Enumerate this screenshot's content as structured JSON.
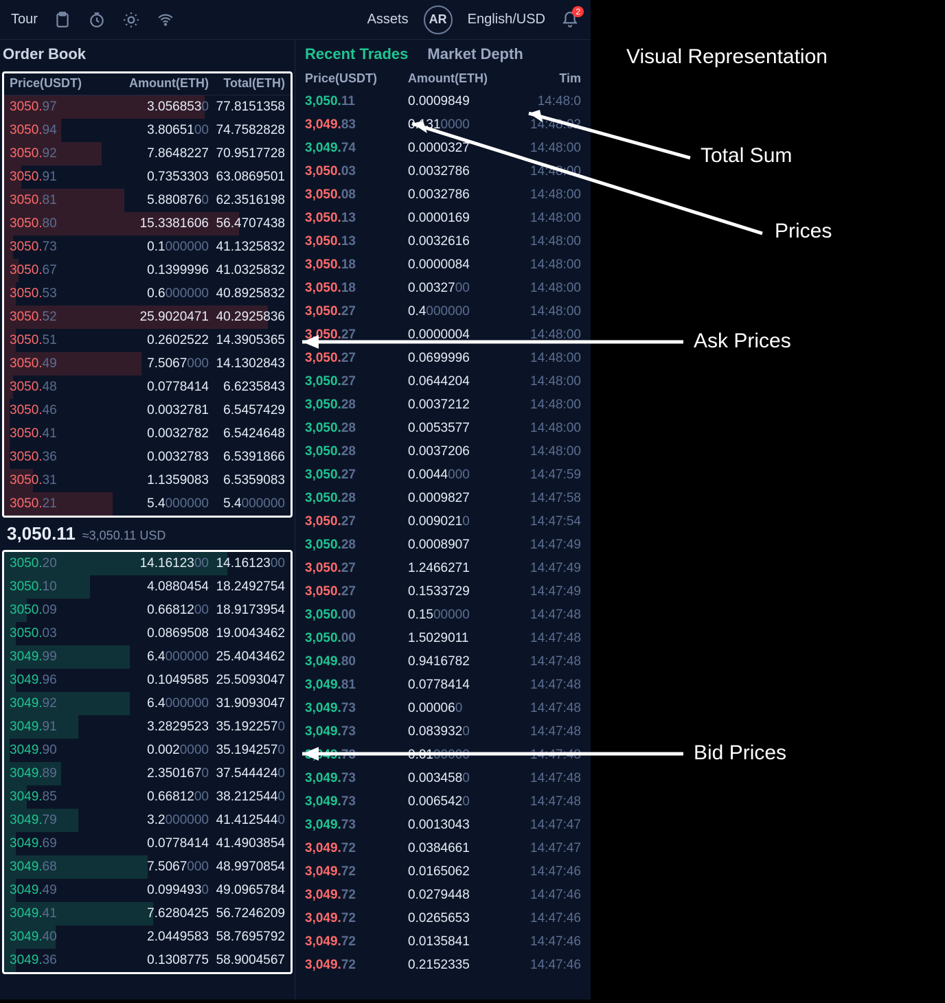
{
  "topbar": {
    "tour": "Tour",
    "assets": "Assets",
    "avatar": "AR",
    "locale": "English/USD",
    "notif_badge": "2"
  },
  "orderbook": {
    "title": "Order Book",
    "head_price": "Price(USDT)",
    "head_amount": "Amount(ETH)",
    "head_total": "Total(ETH)",
    "mid_price_main": "3,050.11",
    "mid_price_sub": "≈3,050.11 USD",
    "asks": [
      {
        "p": [
          "3050.",
          "97"
        ],
        "a": [
          "3.056853",
          "0"
        ],
        "t": [
          "77.8151358",
          ""
        ],
        "d": 70
      },
      {
        "p": [
          "3050.",
          "94"
        ],
        "a": [
          "3.80651",
          "00"
        ],
        "t": [
          "74.7582828",
          ""
        ],
        "d": 20
      },
      {
        "p": [
          "3050.",
          "92"
        ],
        "a": [
          "7.8648227",
          ""
        ],
        "t": [
          "70.9517728",
          ""
        ],
        "d": 34
      },
      {
        "p": [
          "3050.",
          "91"
        ],
        "a": [
          "0.7353303",
          ""
        ],
        "t": [
          "63.0869501",
          ""
        ],
        "d": 6
      },
      {
        "p": [
          "3050.",
          "81"
        ],
        "a": [
          "5.880876",
          "0"
        ],
        "t": [
          "62.3516198",
          ""
        ],
        "d": 42
      },
      {
        "p": [
          "3050.",
          "80"
        ],
        "a": [
          "15.3381606",
          ""
        ],
        "t": [
          "56.4707438",
          ""
        ],
        "d": 82
      },
      {
        "p": [
          "3050.",
          "73"
        ],
        "a": [
          "0.1",
          "000000"
        ],
        "t": [
          "41.1325832",
          ""
        ],
        "d": 3
      },
      {
        "p": [
          "3050.",
          "67"
        ],
        "a": [
          "0.1399996",
          ""
        ],
        "t": [
          "41.0325832",
          ""
        ],
        "d": 5
      },
      {
        "p": [
          "3050.",
          "53"
        ],
        "a": [
          "0.6",
          "000000"
        ],
        "t": [
          "40.8925832",
          ""
        ],
        "d": 4
      },
      {
        "p": [
          "3050.",
          "52"
        ],
        "a": [
          "25.9020471",
          ""
        ],
        "t": [
          "40.2925836",
          ""
        ],
        "d": 92
      },
      {
        "p": [
          "3050.",
          "51"
        ],
        "a": [
          "0.2602522",
          ""
        ],
        "t": [
          "14.3905365",
          ""
        ],
        "d": 4
      },
      {
        "p": [
          "3050.",
          "49"
        ],
        "a": [
          "7.5067",
          "000"
        ],
        "t": [
          "14.1302843",
          ""
        ],
        "d": 48
      },
      {
        "p": [
          "3050.",
          "48"
        ],
        "a": [
          "0.0778414",
          ""
        ],
        "t": [
          "6.6235843",
          ""
        ],
        "d": 3
      },
      {
        "p": [
          "3050.",
          "46"
        ],
        "a": [
          "0.0032781",
          ""
        ],
        "t": [
          "6.5457429",
          ""
        ],
        "d": 2
      },
      {
        "p": [
          "3050.",
          "41"
        ],
        "a": [
          "0.0032782",
          ""
        ],
        "t": [
          "6.5424648",
          ""
        ],
        "d": 2
      },
      {
        "p": [
          "3050.",
          "36"
        ],
        "a": [
          "0.0032783",
          ""
        ],
        "t": [
          "6.5391866",
          ""
        ],
        "d": 2
      },
      {
        "p": [
          "3050.",
          "31"
        ],
        "a": [
          "1.1359083",
          ""
        ],
        "t": [
          "6.5359083",
          ""
        ],
        "d": 10
      },
      {
        "p": [
          "3050.",
          "21"
        ],
        "a": [
          "5.4",
          "000000"
        ],
        "t": [
          "5.4",
          "000000"
        ],
        "d": 38
      }
    ],
    "bids": [
      {
        "p": [
          "3050.",
          "20"
        ],
        "a": [
          "14.16123",
          "00"
        ],
        "t": [
          "14.16123",
          "00"
        ],
        "d": 78
      },
      {
        "p": [
          "3050.",
          "10"
        ],
        "a": [
          "4.0880454",
          ""
        ],
        "t": [
          "18.2492754",
          ""
        ],
        "d": 30
      },
      {
        "p": [
          "3050.",
          "09"
        ],
        "a": [
          "0.66812",
          "00"
        ],
        "t": [
          "18.9173954",
          ""
        ],
        "d": 8
      },
      {
        "p": [
          "3050.",
          "03"
        ],
        "a": [
          "0.0869508",
          ""
        ],
        "t": [
          "19.0043462",
          ""
        ],
        "d": 4
      },
      {
        "p": [
          "3049.",
          "99"
        ],
        "a": [
          "6.4",
          "000000"
        ],
        "t": [
          "25.4043462",
          ""
        ],
        "d": 44
      },
      {
        "p": [
          "3049.",
          "96"
        ],
        "a": [
          "0.1049585",
          ""
        ],
        "t": [
          "25.5093047",
          ""
        ],
        "d": 4
      },
      {
        "p": [
          "3049.",
          "92"
        ],
        "a": [
          "6.4",
          "000000"
        ],
        "t": [
          "31.9093047",
          ""
        ],
        "d": 44
      },
      {
        "p": [
          "3049.",
          "91"
        ],
        "a": [
          "3.2829523",
          ""
        ],
        "t": [
          "35.192257",
          "0"
        ],
        "d": 26
      },
      {
        "p": [
          "3049.",
          "90"
        ],
        "a": [
          "0.002",
          "0000"
        ],
        "t": [
          "35.194257",
          "0"
        ],
        "d": 2
      },
      {
        "p": [
          "3049.",
          "89"
        ],
        "a": [
          "2.350167",
          "0"
        ],
        "t": [
          "37.544424",
          "0"
        ],
        "d": 20
      },
      {
        "p": [
          "3049.",
          "85"
        ],
        "a": [
          "0.66812",
          "00"
        ],
        "t": [
          "38.212544",
          "0"
        ],
        "d": 8
      },
      {
        "p": [
          "3049.",
          "79"
        ],
        "a": [
          "3.2",
          "000000"
        ],
        "t": [
          "41.412544",
          "0"
        ],
        "d": 26
      },
      {
        "p": [
          "3049.",
          "69"
        ],
        "a": [
          "0.0778414",
          ""
        ],
        "t": [
          "41.4903854",
          ""
        ],
        "d": 4
      },
      {
        "p": [
          "3049.",
          "68"
        ],
        "a": [
          "7.5067",
          "000"
        ],
        "t": [
          "48.9970854",
          ""
        ],
        "d": 50
      },
      {
        "p": [
          "3049.",
          "49"
        ],
        "a": [
          "0.099493",
          "0"
        ],
        "t": [
          "49.0965784",
          ""
        ],
        "d": 4
      },
      {
        "p": [
          "3049.",
          "41"
        ],
        "a": [
          "7.6280425",
          ""
        ],
        "t": [
          "56.7246209",
          ""
        ],
        "d": 52
      },
      {
        "p": [
          "3049.",
          "40"
        ],
        "a": [
          "2.0449583",
          ""
        ],
        "t": [
          "58.7695792",
          ""
        ],
        "d": 18
      },
      {
        "p": [
          "3049.",
          "36"
        ],
        "a": [
          "0.1308775",
          ""
        ],
        "t": [
          "58.9004567",
          ""
        ],
        "d": 4
      }
    ]
  },
  "trades": {
    "tab_recent": "Recent Trades",
    "tab_depth": "Market Depth",
    "head_price": "Price(USDT)",
    "head_amount": "Amount(ETH)",
    "head_time": "Tim",
    "rows": [
      {
        "s": "buy",
        "p": [
          "3,050.",
          "11"
        ],
        "a": [
          "0.0009849",
          ""
        ],
        "t": "14:48:0"
      },
      {
        "s": "sell",
        "p": [
          "3,049.",
          "83"
        ],
        "a": [
          "0.131",
          "0000"
        ],
        "t": "14:48:02"
      },
      {
        "s": "buy",
        "p": [
          "3,049.",
          "74"
        ],
        "a": [
          "0.0000327",
          ""
        ],
        "t": "14:48:00"
      },
      {
        "s": "sell",
        "p": [
          "3,050.",
          "03"
        ],
        "a": [
          "0.0032786",
          ""
        ],
        "t": "14:48:00"
      },
      {
        "s": "sell",
        "p": [
          "3,050.",
          "08"
        ],
        "a": [
          "0.0032786",
          ""
        ],
        "t": "14:48:00"
      },
      {
        "s": "sell",
        "p": [
          "3,050.",
          "13"
        ],
        "a": [
          "0.0000169",
          ""
        ],
        "t": "14:48:00"
      },
      {
        "s": "sell",
        "p": [
          "3,050.",
          "13"
        ],
        "a": [
          "0.0032616",
          ""
        ],
        "t": "14:48:00"
      },
      {
        "s": "sell",
        "p": [
          "3,050.",
          "18"
        ],
        "a": [
          "0.0000084",
          ""
        ],
        "t": "14:48:00"
      },
      {
        "s": "sell",
        "p": [
          "3,050.",
          "18"
        ],
        "a": [
          "0.00327",
          "00"
        ],
        "t": "14:48:00"
      },
      {
        "s": "sell",
        "p": [
          "3,050.",
          "27"
        ],
        "a": [
          "0.4",
          "000000"
        ],
        "t": "14:48:00"
      },
      {
        "s": "sell",
        "p": [
          "3,050.",
          "27"
        ],
        "a": [
          "0.0000004",
          ""
        ],
        "t": "14:48:00"
      },
      {
        "s": "sell",
        "p": [
          "3,050.",
          "27"
        ],
        "a": [
          "0.0699996",
          ""
        ],
        "t": "14:48:00"
      },
      {
        "s": "buy",
        "p": [
          "3,050.",
          "27"
        ],
        "a": [
          "0.0644204",
          ""
        ],
        "t": "14:48:00"
      },
      {
        "s": "buy",
        "p": [
          "3,050.",
          "28"
        ],
        "a": [
          "0.0037212",
          ""
        ],
        "t": "14:48:00"
      },
      {
        "s": "buy",
        "p": [
          "3,050.",
          "28"
        ],
        "a": [
          "0.0053577",
          ""
        ],
        "t": "14:48:00"
      },
      {
        "s": "buy",
        "p": [
          "3,050.",
          "28"
        ],
        "a": [
          "0.0037206",
          ""
        ],
        "t": "14:48:00"
      },
      {
        "s": "buy",
        "p": [
          "3,050.",
          "27"
        ],
        "a": [
          "0.0044",
          "000"
        ],
        "t": "14:47:59"
      },
      {
        "s": "buy",
        "p": [
          "3,050.",
          "28"
        ],
        "a": [
          "0.0009827",
          ""
        ],
        "t": "14:47:58"
      },
      {
        "s": "sell",
        "p": [
          "3,050.",
          "27"
        ],
        "a": [
          "0.009021",
          "0"
        ],
        "t": "14:47:54"
      },
      {
        "s": "buy",
        "p": [
          "3,050.",
          "28"
        ],
        "a": [
          "0.0008907",
          ""
        ],
        "t": "14:47:49"
      },
      {
        "s": "sell",
        "p": [
          "3,050.",
          "27"
        ],
        "a": [
          "1.2466271",
          ""
        ],
        "t": "14:47:49"
      },
      {
        "s": "sell",
        "p": [
          "3,050.",
          "27"
        ],
        "a": [
          "0.1533729",
          ""
        ],
        "t": "14:47:49"
      },
      {
        "s": "buy",
        "p": [
          "3,050.",
          "00"
        ],
        "a": [
          "0.15",
          "00000"
        ],
        "t": "14:47:48"
      },
      {
        "s": "buy",
        "p": [
          "3,050.",
          "00"
        ],
        "a": [
          "1.5029011",
          ""
        ],
        "t": "14:47:48"
      },
      {
        "s": "buy",
        "p": [
          "3,049.",
          "80"
        ],
        "a": [
          "0.9416782",
          ""
        ],
        "t": "14:47:48"
      },
      {
        "s": "buy",
        "p": [
          "3,049.",
          "81"
        ],
        "a": [
          "0.0778414",
          ""
        ],
        "t": "14:47:48"
      },
      {
        "s": "buy",
        "p": [
          "3,049.",
          "73"
        ],
        "a": [
          "0.00006",
          "0"
        ],
        "t": "14:47:48"
      },
      {
        "s": "buy",
        "p": [
          "3,049.",
          "73"
        ],
        "a": [
          "0.083932",
          "0"
        ],
        "t": "14:47:48"
      },
      {
        "s": "buy",
        "p": [
          "3,049.",
          "73"
        ],
        "a": [
          "0.01",
          "00000"
        ],
        "t": "14:47:48"
      },
      {
        "s": "buy",
        "p": [
          "3,049.",
          "73"
        ],
        "a": [
          "0.003458",
          "0"
        ],
        "t": "14:47:48"
      },
      {
        "s": "buy",
        "p": [
          "3,049.",
          "73"
        ],
        "a": [
          "0.006542",
          "0"
        ],
        "t": "14:47:48"
      },
      {
        "s": "buy",
        "p": [
          "3,049.",
          "73"
        ],
        "a": [
          "0.0013043",
          ""
        ],
        "t": "14:47:47"
      },
      {
        "s": "sell",
        "p": [
          "3,049.",
          "72"
        ],
        "a": [
          "0.0384661",
          ""
        ],
        "t": "14:47:47"
      },
      {
        "s": "sell",
        "p": [
          "3,049.",
          "72"
        ],
        "a": [
          "0.0165062",
          ""
        ],
        "t": "14:47:46"
      },
      {
        "s": "sell",
        "p": [
          "3,049.",
          "72"
        ],
        "a": [
          "0.0279448",
          ""
        ],
        "t": "14:47:46"
      },
      {
        "s": "sell",
        "p": [
          "3,049.",
          "72"
        ],
        "a": [
          "0.0265653",
          ""
        ],
        "t": "14:47:46"
      },
      {
        "s": "sell",
        "p": [
          "3,049.",
          "72"
        ],
        "a": [
          "0.0135841",
          ""
        ],
        "t": "14:47:46"
      },
      {
        "s": "sell",
        "p": [
          "3,049.",
          "72"
        ],
        "a": [
          "0.2152335",
          ""
        ],
        "t": "14:47:46"
      }
    ]
  },
  "annotations": {
    "title": "Visual Representation",
    "total_sum": "Total Sum",
    "prices": "Prices",
    "ask": "Ask Prices",
    "bid": "Bid Prices"
  }
}
